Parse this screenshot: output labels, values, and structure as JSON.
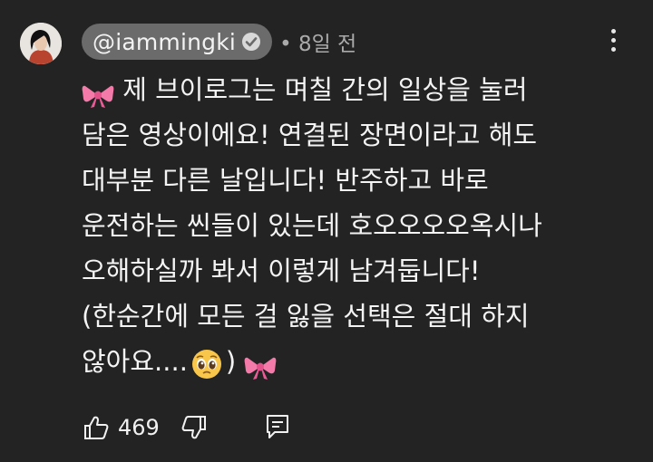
{
  "comment": {
    "author": "@iammingki",
    "time": "• 8일 전",
    "lines": [
      "제 브이로그는 며칠 간의 일상을 눌러",
      "담은 영상이에요! 연결된 장면이라고 해도",
      "대부분 다른 날입니다! 반주하고 바로",
      "운전하는 씬들이 있는데 호오오오오옥시나",
      "오해하실까 봐서 이렇게 남겨둡니다!",
      "(한순간에 모든 걸 잃을 선택은 절대 하지",
      "않아요....",
      ")"
    ],
    "icons": [
      "ribbon-emoji",
      "pleading-face-emoji",
      "ribbon-emoji"
    ]
  },
  "actions": {
    "like_count": "469",
    "icons": [
      "thumbs-up-icon",
      "thumbs-down-icon",
      "reply-icon",
      "more-vert-icon"
    ]
  },
  "colors": {
    "background": "#232323",
    "pill": "#6b6b6b",
    "text": "#f1f1f1",
    "muted": "#aaaaaa",
    "ribbon": "#f06ba0"
  }
}
